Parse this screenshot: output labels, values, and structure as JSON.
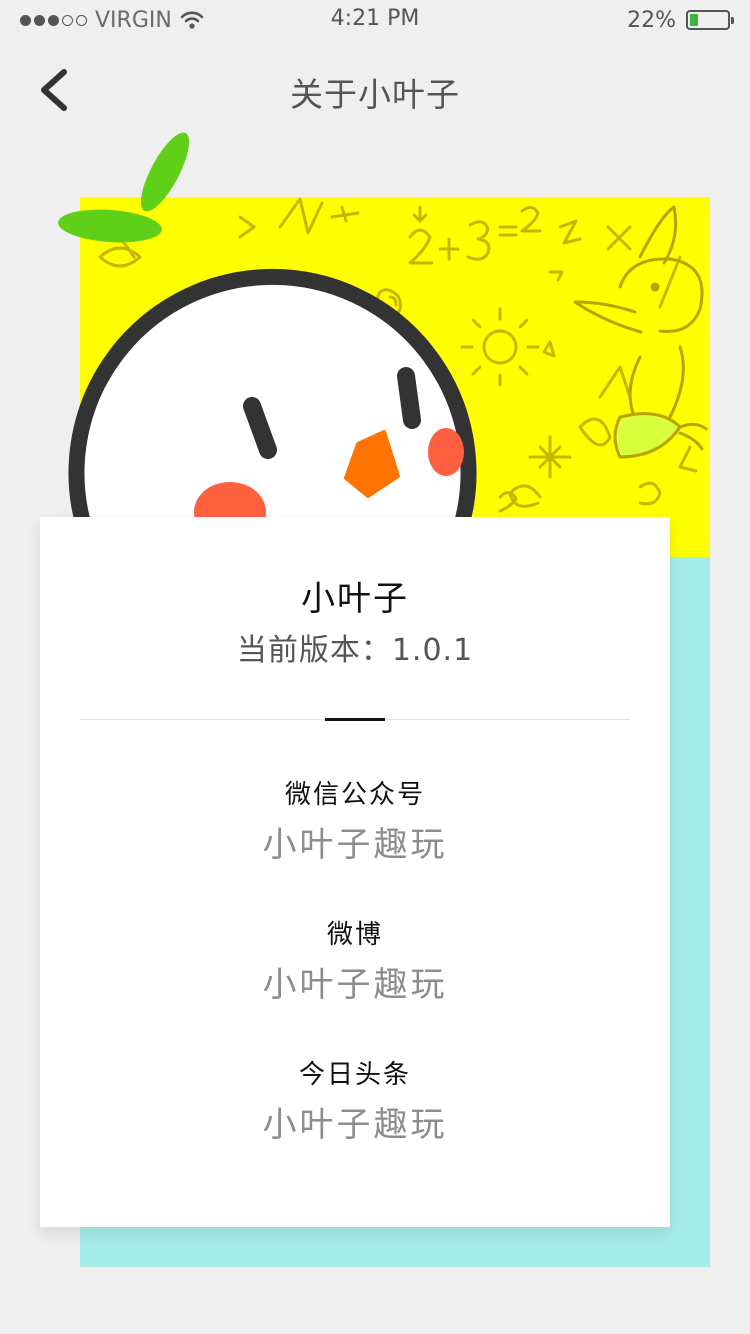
{
  "status_bar": {
    "carrier": "VIRGIN",
    "time": "4:21 PM",
    "battery_percent": "22%",
    "battery_level": 0.22,
    "signal_bars_filled": 3,
    "signal_bars_total": 5
  },
  "nav": {
    "title": "关于小叶子",
    "back_icon": "chevron-left-icon"
  },
  "app": {
    "name": "小叶子",
    "version_text": "当前版本：1.0.1"
  },
  "contacts": [
    {
      "label": "微信公众号",
      "value": "小叶子趣玩"
    },
    {
      "label": "微博",
      "value": "小叶子趣玩"
    },
    {
      "label": "今日头条",
      "value": "小叶子趣玩"
    }
  ],
  "colors": {
    "background": "#efefef",
    "hero_yellow": "#ffff00",
    "cyan_panel": "#a6ede8",
    "leaf_green": "#5fcf17",
    "beak_orange": "#ff7300",
    "cheek_red": "#ff6040",
    "battery_green": "#3cb33c"
  }
}
